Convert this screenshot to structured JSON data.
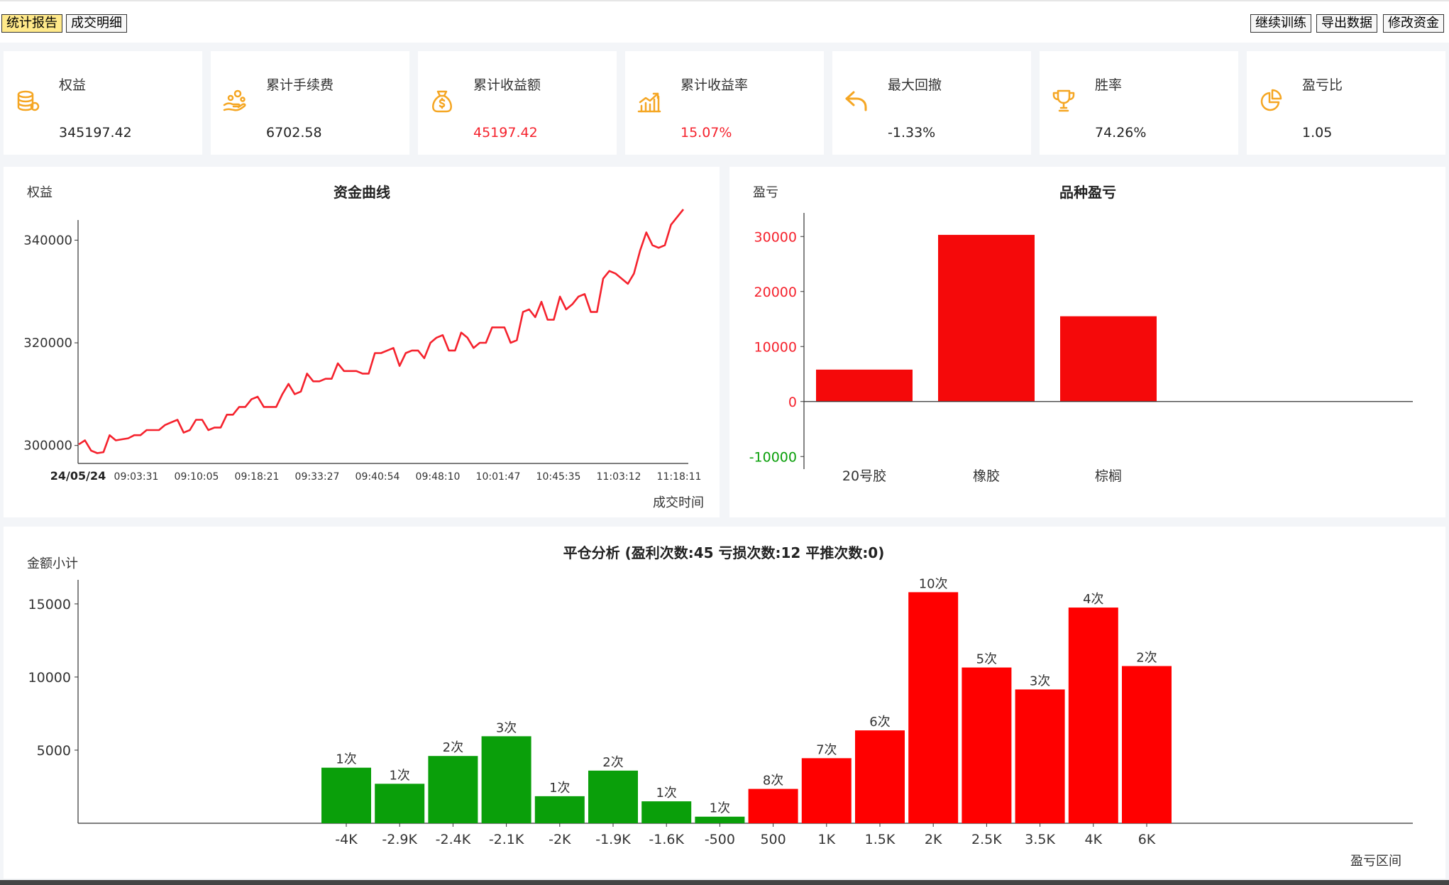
{
  "tabs": [
    {
      "label": "统计报告",
      "active": true
    },
    {
      "label": "成交明细",
      "active": false
    }
  ],
  "actions": [
    "继续训练",
    "导出数据",
    "修改资金"
  ],
  "cards": [
    {
      "label": "权益",
      "value": "345197.42",
      "icon": "coins-stack-icon",
      "color": "normal"
    },
    {
      "label": "累计手续费",
      "value": "6702.58",
      "icon": "hand-coins-icon",
      "color": "normal"
    },
    {
      "label": "累计收益额",
      "value": "45197.42",
      "icon": "money-bag-icon",
      "color": "red"
    },
    {
      "label": "累计收益率",
      "value": "15.07%",
      "icon": "growth-chart-icon",
      "color": "red"
    },
    {
      "label": "最大回撤",
      "value": "-1.33%",
      "icon": "undo-arrow-icon",
      "color": "normal"
    },
    {
      "label": "胜率",
      "value": "74.26%",
      "icon": "trophy-icon",
      "color": "normal"
    },
    {
      "label": "盈亏比",
      "value": "1.05",
      "icon": "pie-chart-icon",
      "color": "normal"
    }
  ],
  "accent": "#f5a623",
  "chart_data": [
    {
      "type": "line",
      "title": "资金曲线",
      "ylabel": "权益",
      "xlabel": "成交时间",
      "date_label": "24/05/24",
      "x_ticks": [
        "09:03:31",
        "09:10:05",
        "09:18:21",
        "09:33:27",
        "09:40:54",
        "09:48:10",
        "10:01:47",
        "10:45:35",
        "11:03:12",
        "11:18:11"
      ],
      "y_ticks": [
        300000,
        320000,
        340000
      ],
      "ylim": [
        296500,
        346000
      ],
      "color": "#f5222d",
      "values": [
        300200,
        301000,
        299000,
        298500,
        298700,
        302000,
        301000,
        301200,
        301400,
        302000,
        302000,
        303000,
        303000,
        303000,
        304000,
        304500,
        305000,
        302500,
        303000,
        305000,
        305000,
        303000,
        303500,
        303500,
        306000,
        306000,
        307500,
        307500,
        309000,
        309500,
        307500,
        307500,
        307500,
        310000,
        312000,
        310000,
        310500,
        314000,
        312500,
        312500,
        313000,
        313000,
        316000,
        314500,
        314500,
        314500,
        314000,
        314000,
        318000,
        318000,
        318500,
        319000,
        315500,
        318000,
        318500,
        318500,
        317000,
        320000,
        321000,
        321500,
        318500,
        318500,
        322000,
        321000,
        319000,
        320000,
        320000,
        323000,
        323000,
        323000,
        320000,
        320500,
        326000,
        326500,
        325000,
        328000,
        324500,
        324500,
        329000,
        326500,
        327500,
        329000,
        329500,
        326000,
        326000,
        332500,
        334000,
        333500,
        332500,
        331500,
        333500,
        338000,
        341500,
        339000,
        338500,
        339000,
        343000,
        344500,
        346000
      ]
    },
    {
      "type": "bar",
      "title": "品种盈亏",
      "ylabel": "盈亏",
      "categories": [
        "20号胶",
        "橡胶",
        "棕榈"
      ],
      "values": [
        5800,
        30300,
        15500
      ],
      "y_ticks": [
        -10000,
        0,
        10000,
        20000,
        30000
      ],
      "ylim": [
        -11000,
        33000
      ],
      "color": "#f5090a",
      "positive_tick_color": "#f5222d",
      "negative_tick_color": "#0a9f0a"
    },
    {
      "type": "bar",
      "title": "平仓分析 (盈利次数:45 亏损次数:12 平推次数:0)",
      "ylabel": "金额小计",
      "xlabel": "盈亏区间",
      "categories": [
        "-4K",
        "-2.9K",
        "-2.4K",
        "-2.1K",
        "-2K",
        "-1.9K",
        "-1.6K",
        "-500",
        "500",
        "1K",
        "1.5K",
        "2K",
        "2.5K",
        "3.5K",
        "4K",
        "6K"
      ],
      "values": [
        3800,
        2700,
        4600,
        5950,
        1850,
        3600,
        1500,
        450,
        2350,
        4450,
        6350,
        15800,
        10650,
        9150,
        14750,
        10750
      ],
      "labels": [
        "1次",
        "1次",
        "2次",
        "3次",
        "1次",
        "2次",
        "1次",
        "1次",
        "8次",
        "7次",
        "6次",
        "10次",
        "5次",
        "3次",
        "4次",
        "2次"
      ],
      "y_ticks": [
        5000,
        10000,
        15000
      ],
      "ylim": [
        0,
        16500
      ],
      "loss_color": "#0a9f0a",
      "profit_color": "#ff0000"
    }
  ]
}
